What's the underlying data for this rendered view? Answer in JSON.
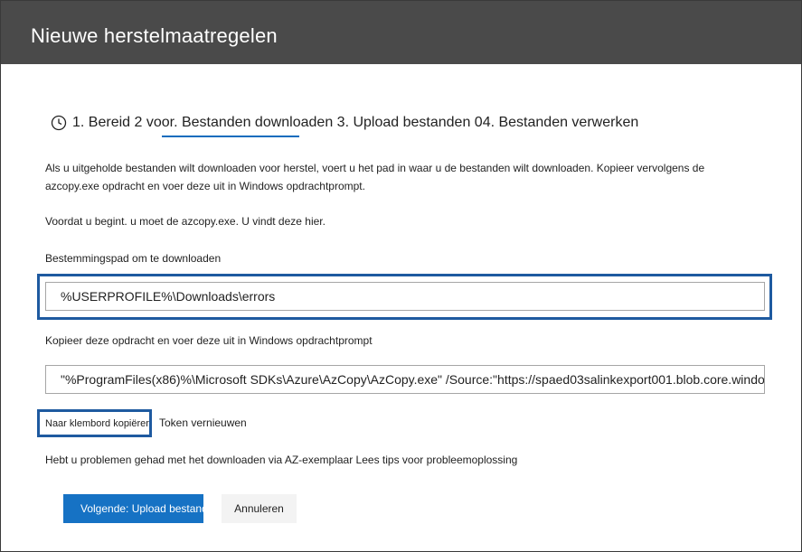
{
  "window": {
    "title": "Nieuwe herstelmaatregelen"
  },
  "steps": {
    "icon": "clock-icon",
    "step1": "1. Bereid 2 voor.",
    "step2": "Bestanden downloaden",
    "step3": "3. Upload bestanden 0",
    "step4": "4. Bestanden verwerken",
    "active_color": "#0f6cbd"
  },
  "content": {
    "intro_line1": "Als u uitgeholde bestanden wilt downloaden voor herstel, voert u het pad in waar u de bestanden wilt downloaden. Kopieer vervolgens de",
    "intro_line2": "azcopy.exe opdracht en voer deze uit in Windows opdrachtprompt.",
    "before_start": "Voordat u begint. u moet de azcopy.exe. U vindt deze hier.",
    "path_label": "Bestemmingspad om te downloaden",
    "path_value": "%USERPROFILE%\\Downloads\\errors",
    "command_label": "Kopieer deze opdracht en voer deze uit in Windows opdrachtprompt",
    "command_value": "\"%ProgramFiles(x86)%\\Microsoft SDKs\\Azure\\AzCopy\\AzCopy.exe\" /Source:\"https://spaed03salinkexport001.blob.core.windo",
    "copy_button": "Naar klembord kopiëren",
    "refresh_token": "Token vernieuwen",
    "help_text": "Hebt u problemen gehad met het downloaden via AZ-exemplaar Lees tips voor probleemoplossing"
  },
  "footer": {
    "next_button": "Volgende: Upload bestanden",
    "cancel_button": "Annuleren"
  },
  "colors": {
    "titlebar": "#4a4a4a",
    "primary": "#1672c4",
    "focus_border": "#1e5aa0"
  }
}
